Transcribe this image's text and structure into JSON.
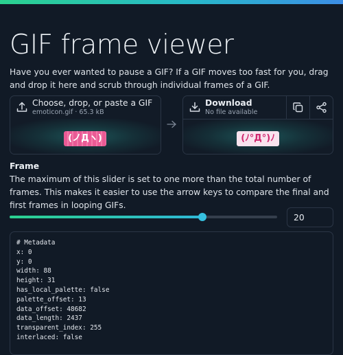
{
  "header": {
    "title": "GIF frame viewer",
    "intro": "Have you ever wanted to pause a GIF? If a GIF moves too fast for you, drag and drop it here and scrub through individual frames of a GIF."
  },
  "input_card": {
    "title": "Choose, drop, or paste a GIF",
    "subtitle": "emoticon.gif · 65.3 kB",
    "preview_text": "(ノДヽ)",
    "icon": "upload-icon"
  },
  "output_card": {
    "title": "Download",
    "subtitle": "No file available",
    "preview_text": "(ﾉ°Д°)ﾉ",
    "icons": [
      "download-icon",
      "copy-icon",
      "share-icon"
    ]
  },
  "frame": {
    "label": "Frame",
    "description": "The maximum of this slider is set to one more than the total number of frames. This makes it easier to use the arrow keys to compare the final and first frames in looping GIFs.",
    "value": "20",
    "slider_fraction": 0.72
  },
  "metadata": {
    "lines": [
      "# Metadata",
      "x: 0",
      "y: 0",
      "width: 88",
      "height: 31",
      "has_local_palette: false",
      "palette_offset: 13",
      "data_offset: 48682",
      "data_length: 2437",
      "transparent_index: 255",
      "interlaced: false"
    ]
  },
  "colors": {
    "accent_start": "#2bd18f",
    "accent_end": "#3c8ee6",
    "background": "#111a26"
  }
}
